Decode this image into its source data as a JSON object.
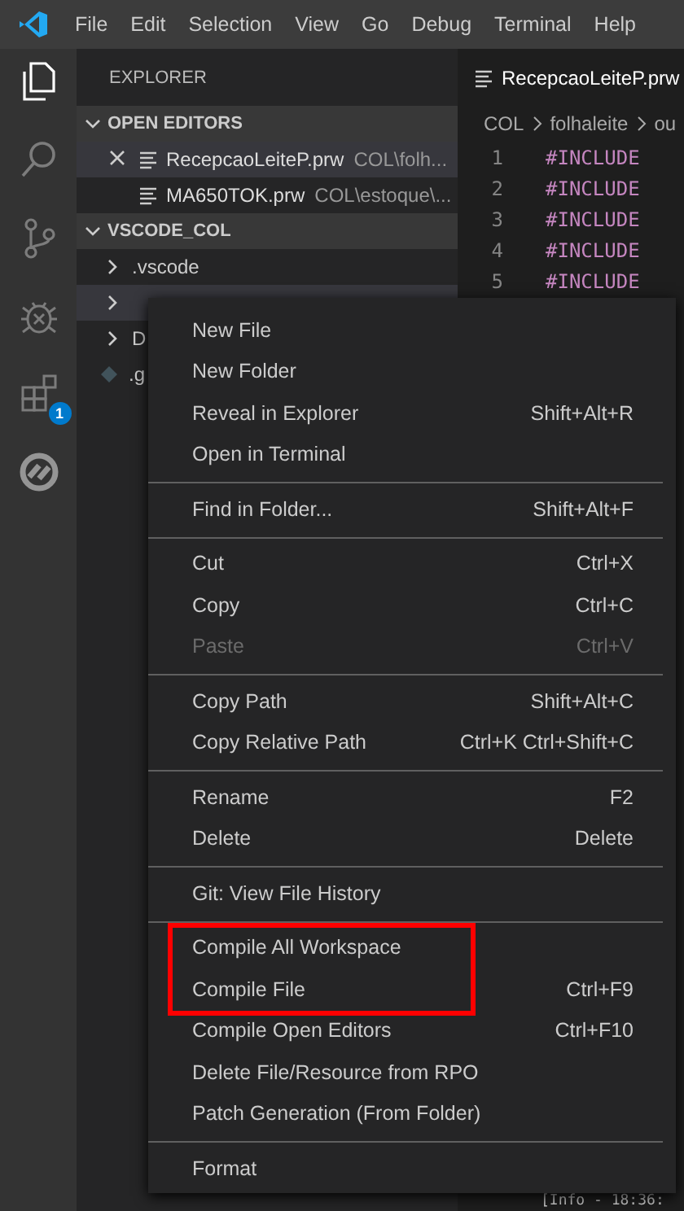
{
  "menubar": {
    "items": [
      "File",
      "Edit",
      "Selection",
      "View",
      "Go",
      "Debug",
      "Terminal",
      "Help"
    ]
  },
  "activity_bar": {
    "items": [
      {
        "kind": "files",
        "selected": true
      },
      {
        "kind": "search",
        "selected": false
      },
      {
        "kind": "source",
        "selected": false
      },
      {
        "kind": "debug",
        "selected": false
      },
      {
        "kind": "extensions",
        "selected": false,
        "badge": "1"
      },
      {
        "kind": "totvs",
        "selected": false
      }
    ]
  },
  "sidebar": {
    "title": "EXPLORER",
    "open_editors": {
      "title": "OPEN EDITORS",
      "expanded": true,
      "files": [
        {
          "name": "RecepcaoLeiteP.prw",
          "path": "COL\\folh...",
          "selected": true
        },
        {
          "name": "MA650TOK.prw",
          "path": "COL\\estoque\\...",
          "selected": false
        }
      ]
    },
    "workspace": {
      "title": "VSCODE_COL",
      "expanded": true,
      "items": [
        {
          "name": ".vscode",
          "kind": "folder",
          "selected": false
        },
        {
          "kind": "folder",
          "selected": true
        },
        {
          "name": "D",
          "kind": "folder",
          "selected": false
        },
        {
          "name": ".g",
          "kind": "file",
          "selected": false
        }
      ]
    }
  },
  "editor": {
    "tab": "RecepcaoLeiteP.prw",
    "breadcrumb": [
      "COL",
      "folhaleite",
      "ou"
    ],
    "lines": [
      {
        "number": "1",
        "code": "#INCLUDE"
      },
      {
        "number": "2",
        "code": "#INCLUDE"
      },
      {
        "number": "3",
        "code": "#INCLUDE"
      },
      {
        "number": "4",
        "code": "#INCLUDE"
      },
      {
        "number": "5",
        "code": "#INCLUDE"
      }
    ],
    "output": "[Info - 18:36:"
  },
  "context_menu": {
    "groups": [
      [
        {
          "label": "New File",
          "disabled": false,
          "highlighted": false
        },
        {
          "label": "New Folder",
          "disabled": false,
          "highlighted": false
        },
        {
          "label": "Reveal in Explorer",
          "shortcut": "Shift+Alt+R",
          "disabled": false,
          "highlighted": false
        },
        {
          "label": "Open in Terminal",
          "disabled": false,
          "highlighted": false
        }
      ],
      [
        {
          "label": "Find in Folder...",
          "shortcut": "Shift+Alt+F",
          "disabled": false,
          "highlighted": false
        }
      ],
      [
        {
          "label": "Cut",
          "shortcut": "Ctrl+X",
          "disabled": false,
          "highlighted": false
        },
        {
          "label": "Copy",
          "shortcut": "Ctrl+C",
          "disabled": false,
          "highlighted": false
        },
        {
          "label": "Paste",
          "shortcut": "Ctrl+V",
          "disabled": true,
          "highlighted": false
        }
      ],
      [
        {
          "label": "Copy Path",
          "shortcut": "Shift+Alt+C",
          "disabled": false,
          "highlighted": false
        },
        {
          "label": "Copy Relative Path",
          "shortcut": "Ctrl+K Ctrl+Shift+C",
          "disabled": false,
          "highlighted": false
        }
      ],
      [
        {
          "label": "Rename",
          "shortcut": "F2",
          "disabled": false,
          "highlighted": false
        },
        {
          "label": "Delete",
          "shortcut": "Delete",
          "disabled": false,
          "highlighted": false
        }
      ],
      [
        {
          "label": "Git: View File History",
          "disabled": false,
          "highlighted": false
        }
      ],
      [
        {
          "label": "Compile All Workspace",
          "disabled": false,
          "highlighted": true
        },
        {
          "label": "Compile File",
          "shortcut": "Ctrl+F9",
          "disabled": false,
          "highlighted": true
        },
        {
          "label": "Compile Open Editors",
          "shortcut": "Ctrl+F10",
          "disabled": false,
          "highlighted": false
        },
        {
          "label": "Delete File/Resource from RPO",
          "disabled": false,
          "highlighted": false
        },
        {
          "label": "Patch Generation (From Folder)",
          "disabled": false,
          "highlighted": false
        }
      ],
      [
        {
          "label": "Format",
          "disabled": false,
          "highlighted": false
        }
      ]
    ]
  }
}
